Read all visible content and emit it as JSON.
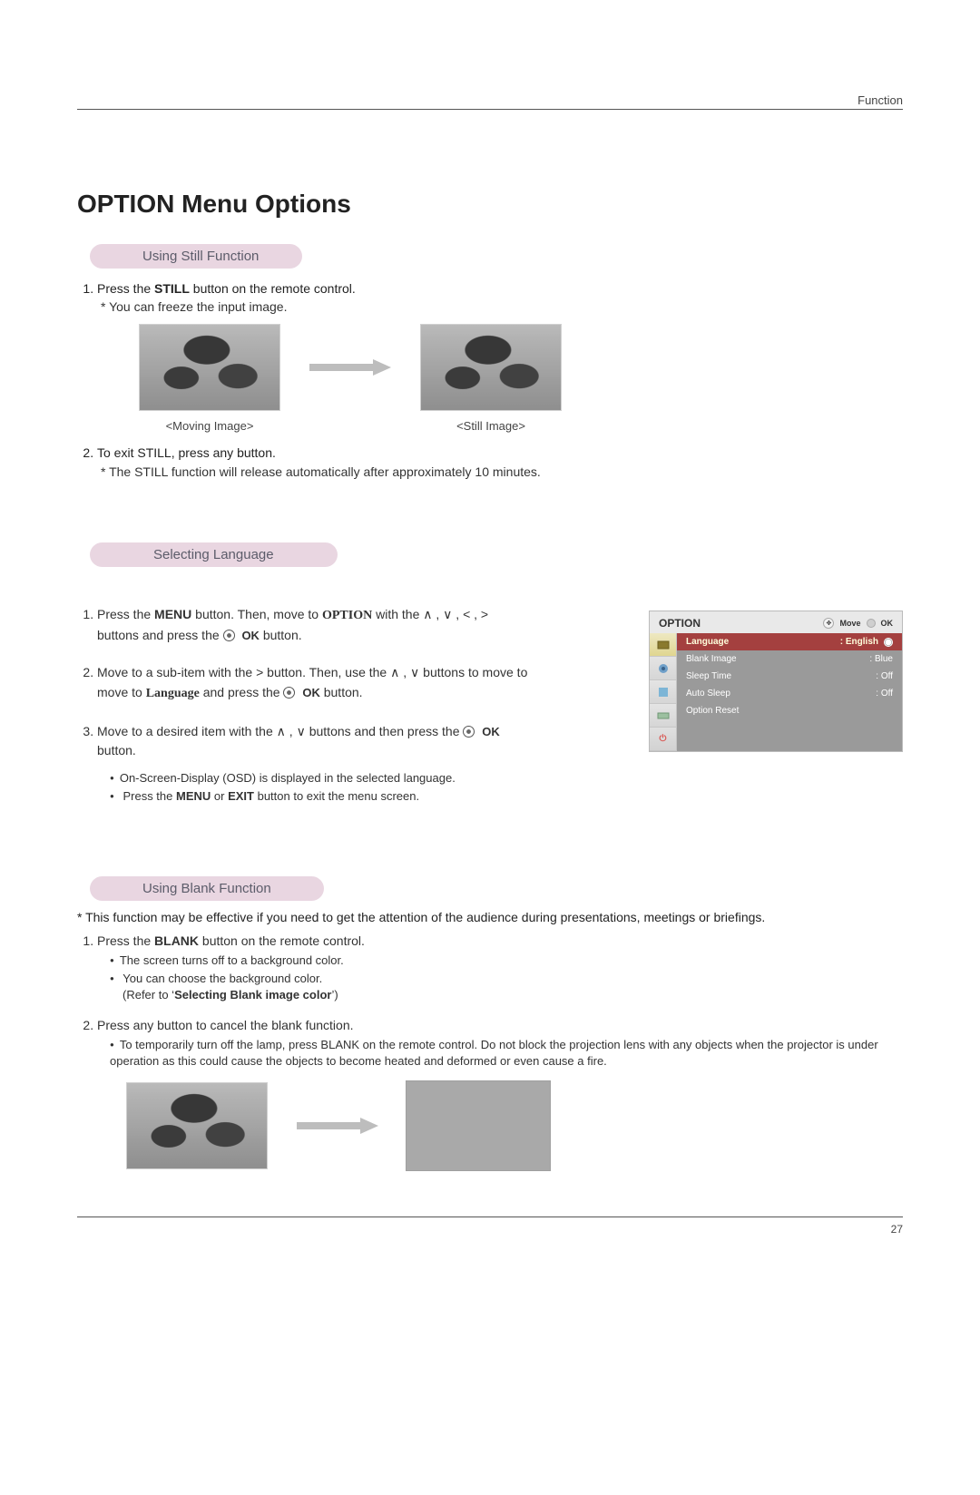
{
  "header": {
    "section_label": "Function"
  },
  "title": "OPTION Menu Options",
  "still": {
    "heading": "Using Still Function",
    "step1_a": "Press the ",
    "step1_b": "STILL",
    "step1_c": " button on the remote control.",
    "step1_note": "* You can freeze the input image.",
    "caption_moving": "<Moving Image>",
    "caption_still": "<Still Image>",
    "step2": "To exit STILL, press any button.",
    "step2_note": "* The STILL function will release automatically after approximately 10 minutes."
  },
  "lang": {
    "heading": "Selecting Language",
    "s1_a": "Press the ",
    "s1_b": "MENU",
    "s1_c": " button. Then, move to ",
    "s1_d": "OPTION",
    "s1_e": " with the ",
    "arrows4": "∧ , ∨ , < , >",
    "s1_f": " buttons and press the ",
    "s1_g": "OK",
    "s1_h": " button.",
    "s2_a": "Move to a sub-item with the ",
    "gt": ">",
    "s2_b": " button. Then, use the ",
    "arrows2": "∧ , ∨",
    "s2_c": " buttons to move to ",
    "s2_d": "Language",
    "s2_e": " and press the ",
    "s3_a": "Move to a desired item with the ",
    "s3_b": " buttons and then press the ",
    "s3_c": " button.",
    "b1": "On-Screen-Display (OSD) is displayed in the selected language.",
    "b2_a": "Press the ",
    "b2_b": "MENU",
    "b2_c": " or ",
    "b2_d": "EXIT",
    "b2_e": " button to exit the menu screen."
  },
  "osd": {
    "title": "OPTION",
    "move": "Move",
    "ok": "OK",
    "rows": [
      {
        "label": "Language",
        "value": ": English"
      },
      {
        "label": "Blank Image",
        "value": ": Blue"
      },
      {
        "label": "Sleep Time",
        "value": ": Off"
      },
      {
        "label": "Auto Sleep",
        "value": ": Off"
      },
      {
        "label": "Option Reset",
        "value": ""
      }
    ]
  },
  "blank": {
    "heading": "Using Blank Function",
    "intro": "* This function may be effective if you need to get the attention of the audience during presentations, meetings or briefings.",
    "s1_a": "Press the ",
    "s1_b": "BLANK",
    "s1_c": " button on the remote control.",
    "s1_bul1": "The screen turns off to a background color.",
    "s1_bul2": "You can choose the background color.",
    "s1_bul2_ref_a": "(Refer to ‘",
    "s1_bul2_ref_b": "Selecting Blank image color",
    "s1_bul2_ref_c": "’)",
    "s2": "Press any button to cancel the blank function.",
    "s2_bul": "To temporarily turn off the lamp, press BLANK on the remote control. Do not block the projection lens with any objects when the projector is under operation as this could cause the objects to become heated and deformed or even cause a fire."
  },
  "page_number": "27"
}
